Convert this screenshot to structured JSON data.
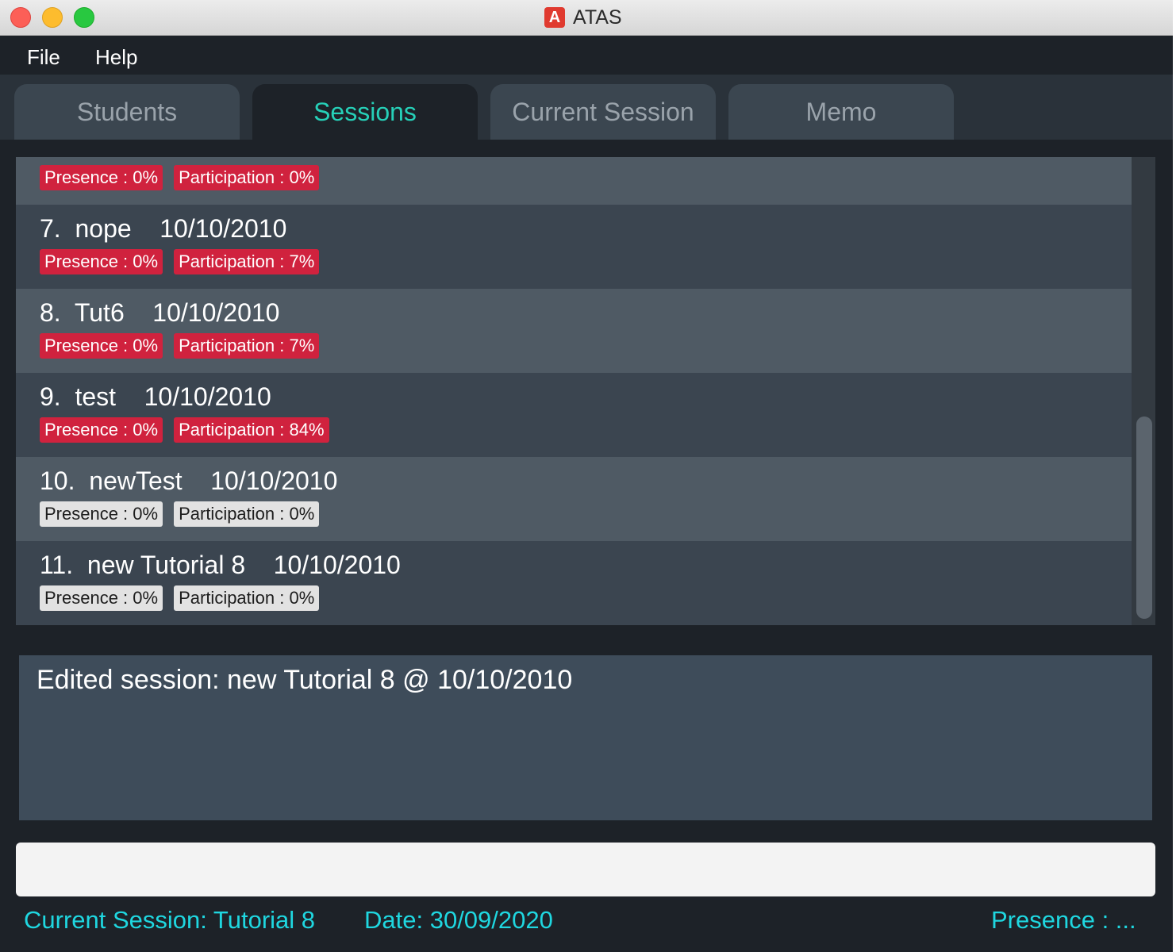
{
  "window": {
    "title": "ATAS",
    "app_icon_letter": "A"
  },
  "menu": {
    "file": "File",
    "help": "Help"
  },
  "tabs": [
    {
      "label": "Students",
      "active": false
    },
    {
      "label": "Sessions",
      "active": true
    },
    {
      "label": "Current Session",
      "active": false
    },
    {
      "label": "Memo",
      "active": false
    }
  ],
  "sessions": [
    {
      "title": "",
      "presence": "Presence : 0%",
      "participation": "Participation : 0%",
      "tag_color": "red"
    },
    {
      "title": "7.  nope    10/10/2010",
      "presence": "Presence : 0%",
      "participation": "Participation : 7%",
      "tag_color": "red"
    },
    {
      "title": "8.  Tut6    10/10/2010",
      "presence": "Presence : 0%",
      "participation": "Participation : 7%",
      "tag_color": "red"
    },
    {
      "title": "9.  test    10/10/2010",
      "presence": "Presence : 0%",
      "participation": "Participation : 84%",
      "tag_color": "red"
    },
    {
      "title": "10.  newTest    10/10/2010",
      "presence": "Presence : 0%",
      "participation": "Participation : 0%",
      "tag_color": "grey"
    },
    {
      "title": "11.  new Tutorial 8    10/10/2010",
      "presence": "Presence : 0%",
      "participation": "Participation : 0%",
      "tag_color": "grey"
    }
  ],
  "result": {
    "message": "Edited session: new Tutorial 8 @ 10/10/2010"
  },
  "command": {
    "value": ""
  },
  "status": {
    "current_session": "Current Session: Tutorial 8",
    "date": "Date: 30/09/2020",
    "presence": "Presence : ..."
  },
  "colors": {
    "accent": "#26d0b8",
    "status_text": "#1fd7e0",
    "tag_red": "#d0223e",
    "tag_grey": "#e2e2e2"
  }
}
